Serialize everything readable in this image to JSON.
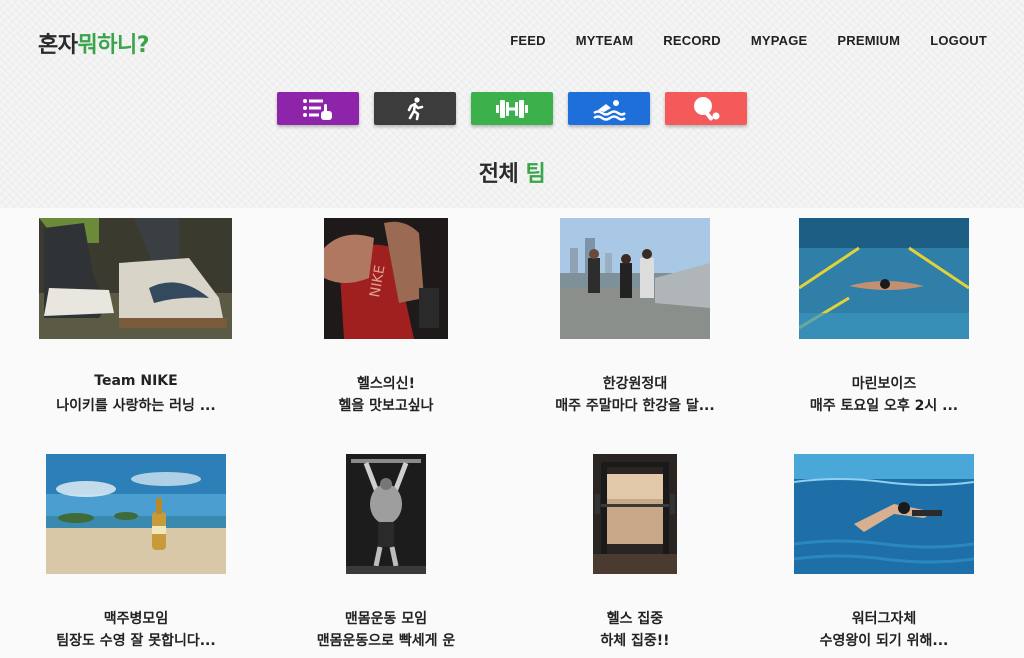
{
  "header": {
    "logo_dark": "혼자",
    "logo_green": "뭐하니?",
    "nav": [
      "FEED",
      "MYTEAM",
      "RECORD",
      "MYPAGE",
      "PREMIUM",
      "LOGOUT"
    ]
  },
  "categories": [
    {
      "name": "all",
      "color": "#8e24aa",
      "icon": "list-hand-icon"
    },
    {
      "name": "running",
      "color": "#3c3c3c",
      "icon": "runner-icon"
    },
    {
      "name": "fitness",
      "color": "#3cb04a",
      "icon": "dumbbell-icon"
    },
    {
      "name": "swimming",
      "color": "#1e6fd9",
      "icon": "swimmer-icon"
    },
    {
      "name": "table-tennis",
      "color": "#f45a5a",
      "icon": "ping-pong-icon"
    }
  ],
  "section": {
    "title_dark": "전체",
    "title_green": "팀"
  },
  "teams": [
    {
      "title": "Team NIKE",
      "desc": "나이키를 사랑하는 러닝 ..."
    },
    {
      "title": "헬스의신!",
      "desc": "헬을 맛보고싶나"
    },
    {
      "title": "한강원정대",
      "desc": "매주 주말마다 한강을 달..."
    },
    {
      "title": "마린보이즈",
      "desc": "매주 토요일 오후 2시 ..."
    },
    {
      "title": "맥주병모임",
      "desc": "팀장도 수영 잘 못합니다..."
    },
    {
      "title": "맨몸운동 모임",
      "desc": "맨몸운동으로 빡세게 운"
    },
    {
      "title": "헬스 집중",
      "desc": "하체 집중!!"
    },
    {
      "title": "워터그자체",
      "desc": "수영왕이 되기 위해..."
    }
  ]
}
